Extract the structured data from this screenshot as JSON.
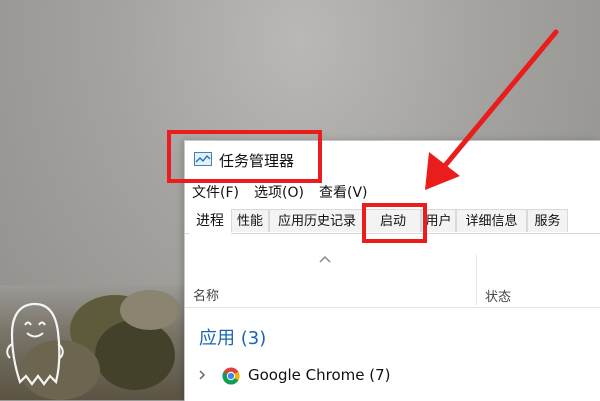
{
  "window": {
    "title": "任务管理器"
  },
  "menu": [
    {
      "label": "文件(F)"
    },
    {
      "label": "选项(O)"
    },
    {
      "label": "查看(V)"
    }
  ],
  "tabs": [
    {
      "label": "进程",
      "active": true
    },
    {
      "label": "性能",
      "active": false
    },
    {
      "label": "应用历史记录",
      "active": false
    },
    {
      "label": "启动",
      "active": false
    },
    {
      "label": "用户",
      "active": false
    },
    {
      "label": "详细信息",
      "active": false
    },
    {
      "label": "服务",
      "active": false
    }
  ],
  "columns": {
    "name": "名称",
    "status": "状态"
  },
  "group": {
    "title": "应用 (3)"
  },
  "processes": [
    {
      "name": "Google Chrome (7)",
      "icon": "chrome-icon"
    }
  ],
  "colors": {
    "annotation": "#ea1c1c",
    "group_title": "#1a64b6"
  }
}
